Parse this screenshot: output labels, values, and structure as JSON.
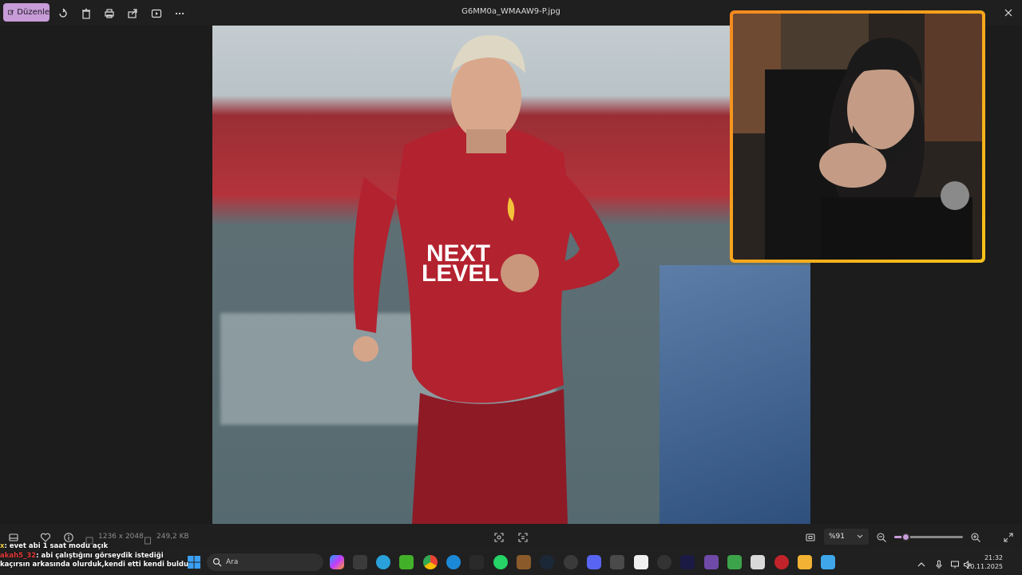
{
  "toolbar": {
    "edit_label": "Düzenle",
    "file_title": "G6MM0a_WMAAW9-P.jpg",
    "icons": [
      "rotate-icon",
      "delete-icon",
      "print-icon",
      "share-icon",
      "slideshow-icon",
      "more-icon"
    ]
  },
  "info": {
    "dimensions": "1236 x 2048",
    "file_size": "249,2 KB",
    "zoom_value": "%91",
    "zoom_fraction": 0.16
  },
  "chat": {
    "messages": [
      {
        "user": "x",
        "text": ": evet abi 1 saat modu açık"
      },
      {
        "user": "akah5_32",
        "text": ": abi çalıştığını görseydik istediği"
      },
      {
        "user": "",
        "text": "kaçırsın arkasında olurduk,kendi etti kendi buldu"
      }
    ]
  },
  "taskbar": {
    "search_placeholder": "Ara",
    "time": "21:32",
    "date": "20.11.2025"
  },
  "colors": {
    "accent": "#c89bd9",
    "webcam_border": "#f58a1f",
    "jersey": "#b3222f"
  },
  "photo": {
    "jersey_text_line1": "NEXT",
    "jersey_text_line2": "LEVEL"
  }
}
